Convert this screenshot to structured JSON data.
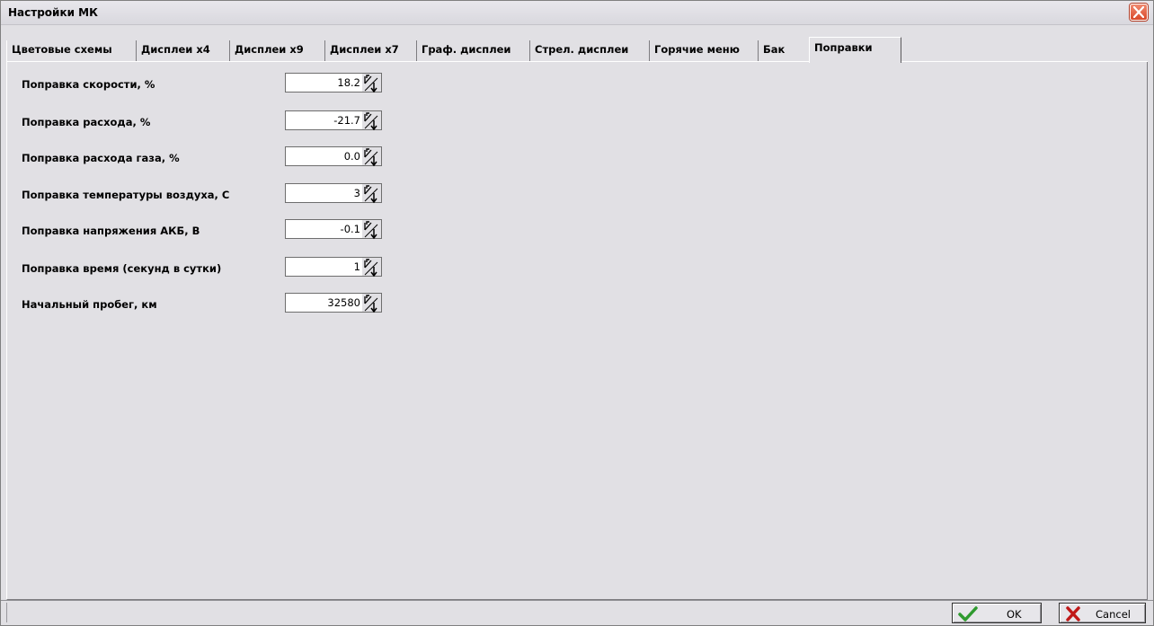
{
  "window": {
    "title": "Настройки МК"
  },
  "tabs": [
    "Цветовые схемы",
    "Дисплеи x4",
    "Дисплеи x9",
    "Дисплеи x7",
    "Граф. дисплеи",
    "Стрел. дисплеи",
    "Горячие меню",
    "Бак",
    "Поправки"
  ],
  "active_tab": "Поправки",
  "fields": [
    {
      "label": "Поправка скорости, %",
      "value": "18.2"
    },
    {
      "label": "Поправка расхода, %",
      "value": "-21.7"
    },
    {
      "label": "Поправка расхода газа, %",
      "value": "0.0"
    },
    {
      "label": "Поправка температуры воздуха, С",
      "value": "3"
    },
    {
      "label": "Поправка напряжения АКБ, В",
      "value": "-0.1"
    },
    {
      "label": "Поправка время (секунд в сутки)",
      "value": "1"
    },
    {
      "label": "Начальный пробег, км",
      "value": "32580"
    }
  ],
  "buttons": {
    "ok": "OK",
    "cancel": "Cancel"
  },
  "icons": {
    "close": "close-icon",
    "spin": "spin-arrows-icon",
    "ok": "check-icon",
    "cancel": "x-icon"
  },
  "colors": {
    "ok_check": "#2f9a2f",
    "cancel_x": "#c01818",
    "close": "#d9482a"
  }
}
